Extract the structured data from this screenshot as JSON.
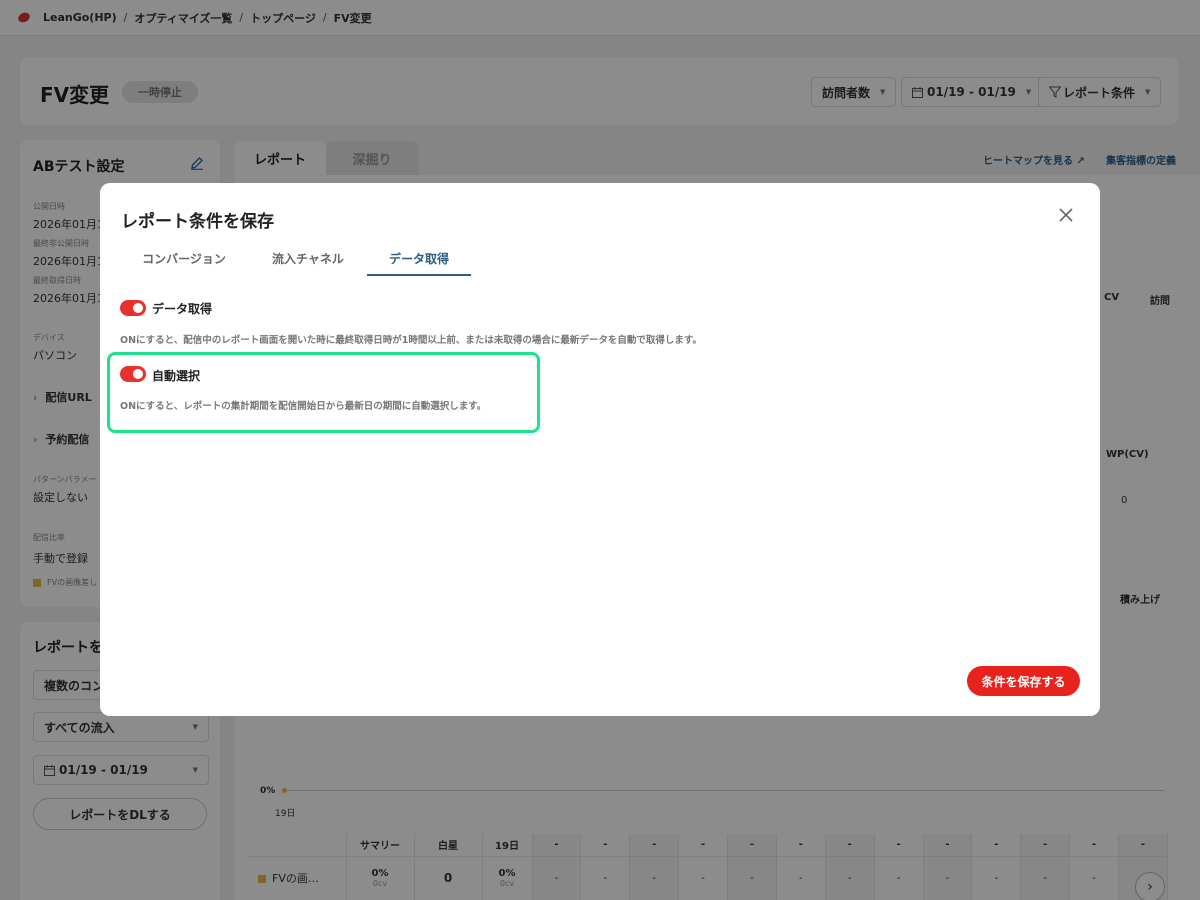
{
  "breadcrumb": {
    "items": [
      "LeanGo(HP)",
      "オプティマイズ一覧",
      "トップページ",
      "FV変更"
    ],
    "sep": "/"
  },
  "header": {
    "title": "FV変更",
    "status": "一時停止",
    "metric_select": "訪問者数",
    "date_select": "01/19 - 01/19",
    "report_condition": "レポート条件"
  },
  "sidebar": {
    "title": "ABテスト設定",
    "published_label": "公開日時",
    "published_value": "2026年01月19",
    "last_unpublished_label": "最終非公開日時",
    "last_unpublished_value": "2026年01月19",
    "last_fetched_label": "最終取得日時",
    "last_fetched_value": "2026年01月19",
    "device_label": "デバイス",
    "device_value": "パソコン",
    "delivery_url": "配信URL",
    "scheduled_delivery": "予約配信",
    "pattern_param_label": "パターンパラメー",
    "pattern_param_value": "設定しない",
    "ratio_label": "配信比率",
    "ratio_value": "手動で登録",
    "legend_item": "FVの画像差し"
  },
  "sidebar2": {
    "title": "レポートを",
    "conversion_select": "複数のコン",
    "inflow_select": "すべての流入",
    "date_select": "01/19 - 01/19",
    "download_button": "レポートをDLする"
  },
  "main": {
    "tab_report": "レポート",
    "tab_deep": "深掘り",
    "heatmap_link": "ヒートマップを見る",
    "metric_link": "集客指標の定義",
    "frag_cv": "CV",
    "frag_visit": "訪問",
    "frag_wpcv": "WP(CV)",
    "frag_zero": "0",
    "stack_label": "積み上げ",
    "chart_y_label": "0%",
    "chart_x_label": "19日"
  },
  "table": {
    "headers": [
      "",
      "サマリー",
      "白星",
      "19日",
      "-",
      "-",
      "-",
      "-",
      "-",
      "-",
      "-",
      "-",
      "-",
      "-",
      "-",
      "-",
      "-"
    ],
    "row_name": "FVの画…",
    "summary_pct": "0%",
    "summary_cv": "0cv",
    "shirohoshi": "0",
    "day_pct": "0%",
    "day_cv": "0cv",
    "dash": "-"
  },
  "modal": {
    "title": "レポート条件を保存",
    "tabs": [
      "コンバージョン",
      "流入チャネル",
      "データ取得"
    ],
    "active_tab": "データ取得",
    "option1_label": "データ取得",
    "option1_desc": "ONにすると、配信中のレポート画面を開いた時に最終取得日時が1時間以上前、または未取得の場合に最新データを自動で取得します。",
    "option1_on": true,
    "option2_label": "自動選択",
    "option2_desc": "ONにすると、レポートの集計期間を配信開始日から最新日の期間に自動選択します。",
    "option2_on": true,
    "save_button": "条件を保存する"
  },
  "colors": {
    "accent_red": "#e8231e",
    "highlight_green": "#1de38a",
    "active_tab_blue": "#2a5d8a",
    "legend_yellow": "#e5b84a"
  }
}
